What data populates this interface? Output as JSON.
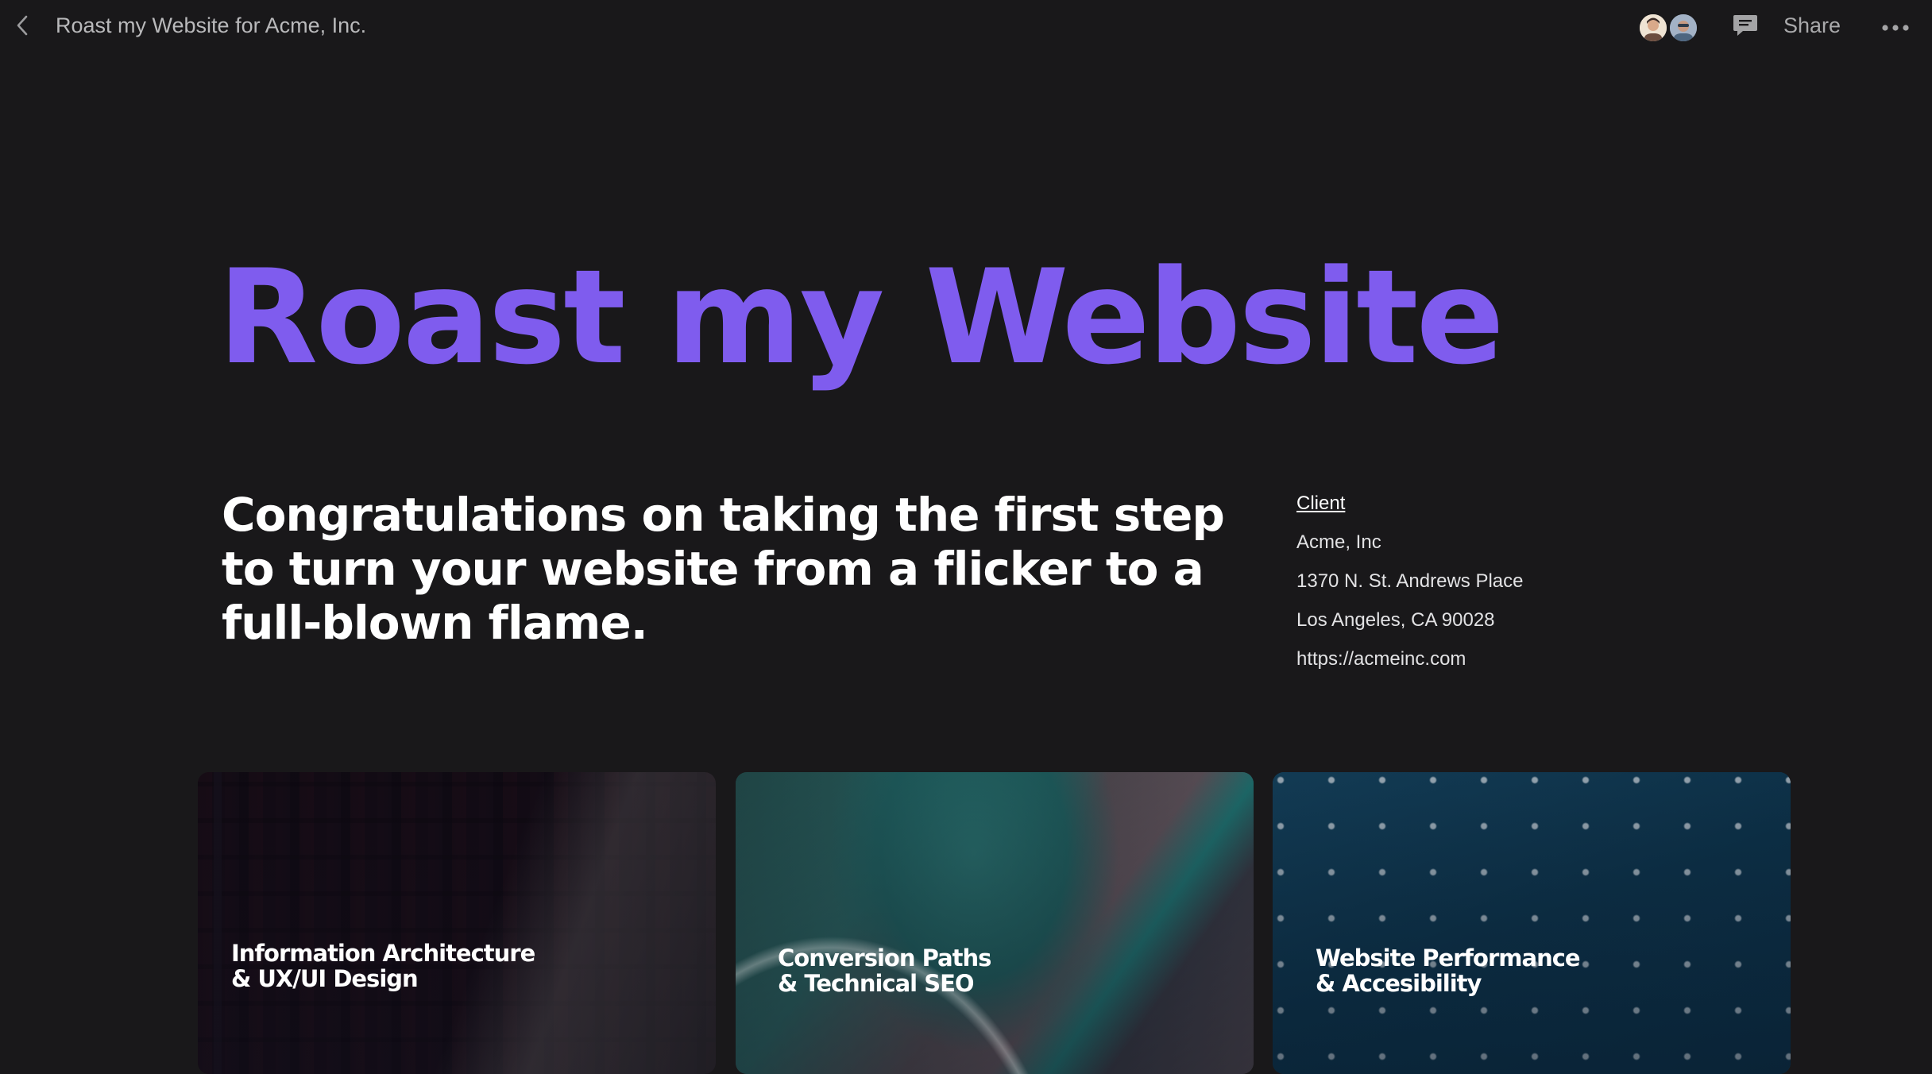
{
  "topbar": {
    "doc_title": "Roast my Website for Acme, Inc.",
    "share_label": "Share",
    "icons": {
      "back": "chevron-left-icon",
      "comment": "comment-icon",
      "more": "more-horizontal-icon"
    },
    "avatars": [
      "avatar-user-1",
      "avatar-user-2"
    ]
  },
  "hero": {
    "title": "Roast my Website",
    "intro": "Congratulations on taking the first step to turn your website from a flicker to a full-blown flame."
  },
  "client": {
    "heading": "Client",
    "name": "Acme, Inc",
    "address_line1": "1370 N. St. Andrews Place",
    "address_line2": "Los Angeles, CA 90028",
    "website": "https://acmeinc.com"
  },
  "cards": [
    {
      "line1": "Information Architecture",
      "line2": "& UX/UI Design"
    },
    {
      "line1": "Conversion Paths",
      "line2": "& Technical SEO"
    },
    {
      "line1": "Website Performance",
      "line2": "& Accesibility"
    }
  ],
  "colors": {
    "background": "#19181a",
    "accent": "#7f5cee",
    "text": "#ffffff",
    "muted": "#b9b9bb"
  }
}
